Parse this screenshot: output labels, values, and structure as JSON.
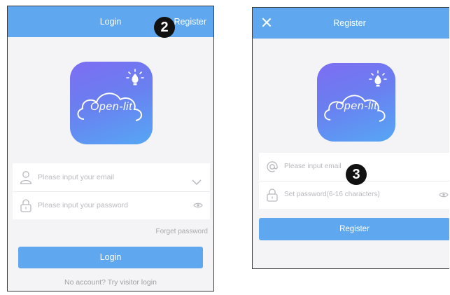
{
  "login_screen": {
    "header_title": "Login",
    "header_register_link": "Register",
    "logo_text": "Open-lit",
    "email_placeholder": "Please input your email",
    "password_placeholder": "Please input your password",
    "forget_password": "Forget password",
    "login_button": "Login",
    "visitor_login": "No account? Try visitor login",
    "step_badge": "2"
  },
  "register_screen": {
    "header_title": "Register",
    "logo_text": "Open-lit",
    "email_placeholder": "Please input email",
    "password_placeholder": "Set password(6-16 characters)",
    "register_button": "Register",
    "step_badge": "3"
  },
  "colors": {
    "header_blue": "#5fa8f0",
    "background": "#f4f4f6",
    "badge": "#111111"
  },
  "icons": [
    "close-icon",
    "bulb-icon",
    "cloud-icon",
    "user-icon",
    "lock-icon",
    "at-sign-icon",
    "chevron-down-icon",
    "eye-icon"
  ]
}
